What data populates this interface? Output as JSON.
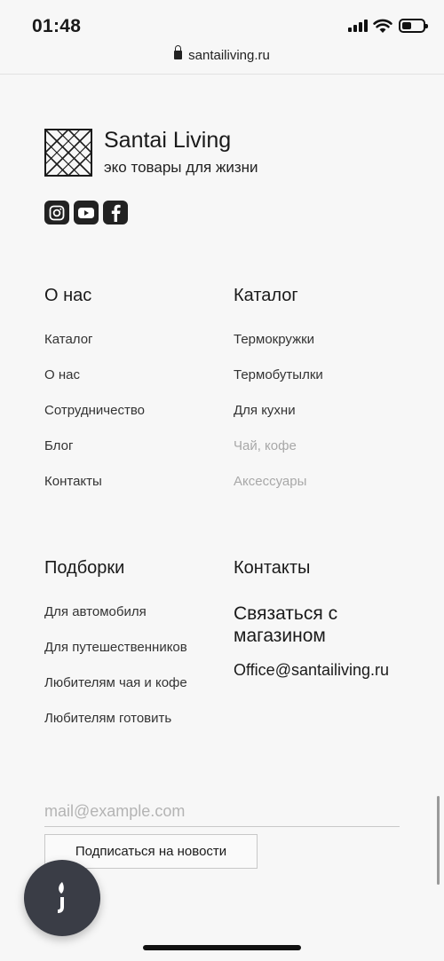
{
  "status_bar": {
    "time": "01:48"
  },
  "browser": {
    "url": "santailiving.ru"
  },
  "brand": {
    "name": "Santai Living",
    "tagline": "эко товары для жизни"
  },
  "social": [
    {
      "icon": "instagram-icon"
    },
    {
      "icon": "youtube-icon"
    },
    {
      "icon": "facebook-icon"
    }
  ],
  "about": {
    "title": "О нас",
    "links": [
      "Каталог",
      "О нас",
      "Сотрудничество",
      "Блог",
      "Контакты"
    ]
  },
  "catalog": {
    "title": "Каталог",
    "links": [
      "Термокружки",
      "Термобутылки",
      "Для кухни",
      "Чай, кофе",
      "Аксессуары"
    ],
    "muted_indices": [
      3,
      4
    ]
  },
  "collections": {
    "title": "Подборки",
    "links": [
      "Для автомобиля",
      "Для путешественников",
      "Любителям чая и кофе",
      "Любителям готовить"
    ]
  },
  "contacts": {
    "title": "Контакты",
    "heading": "Связаться с магазином",
    "email": "Office@santailiving.ru"
  },
  "subscribe": {
    "placeholder": "mail@example.com",
    "button_label": "Подписаться на новости"
  },
  "colors": {
    "background": "#f7f7f7",
    "text": "#1a1a1a",
    "muted": "#a8a8a8",
    "fab": "#3a3d46"
  }
}
